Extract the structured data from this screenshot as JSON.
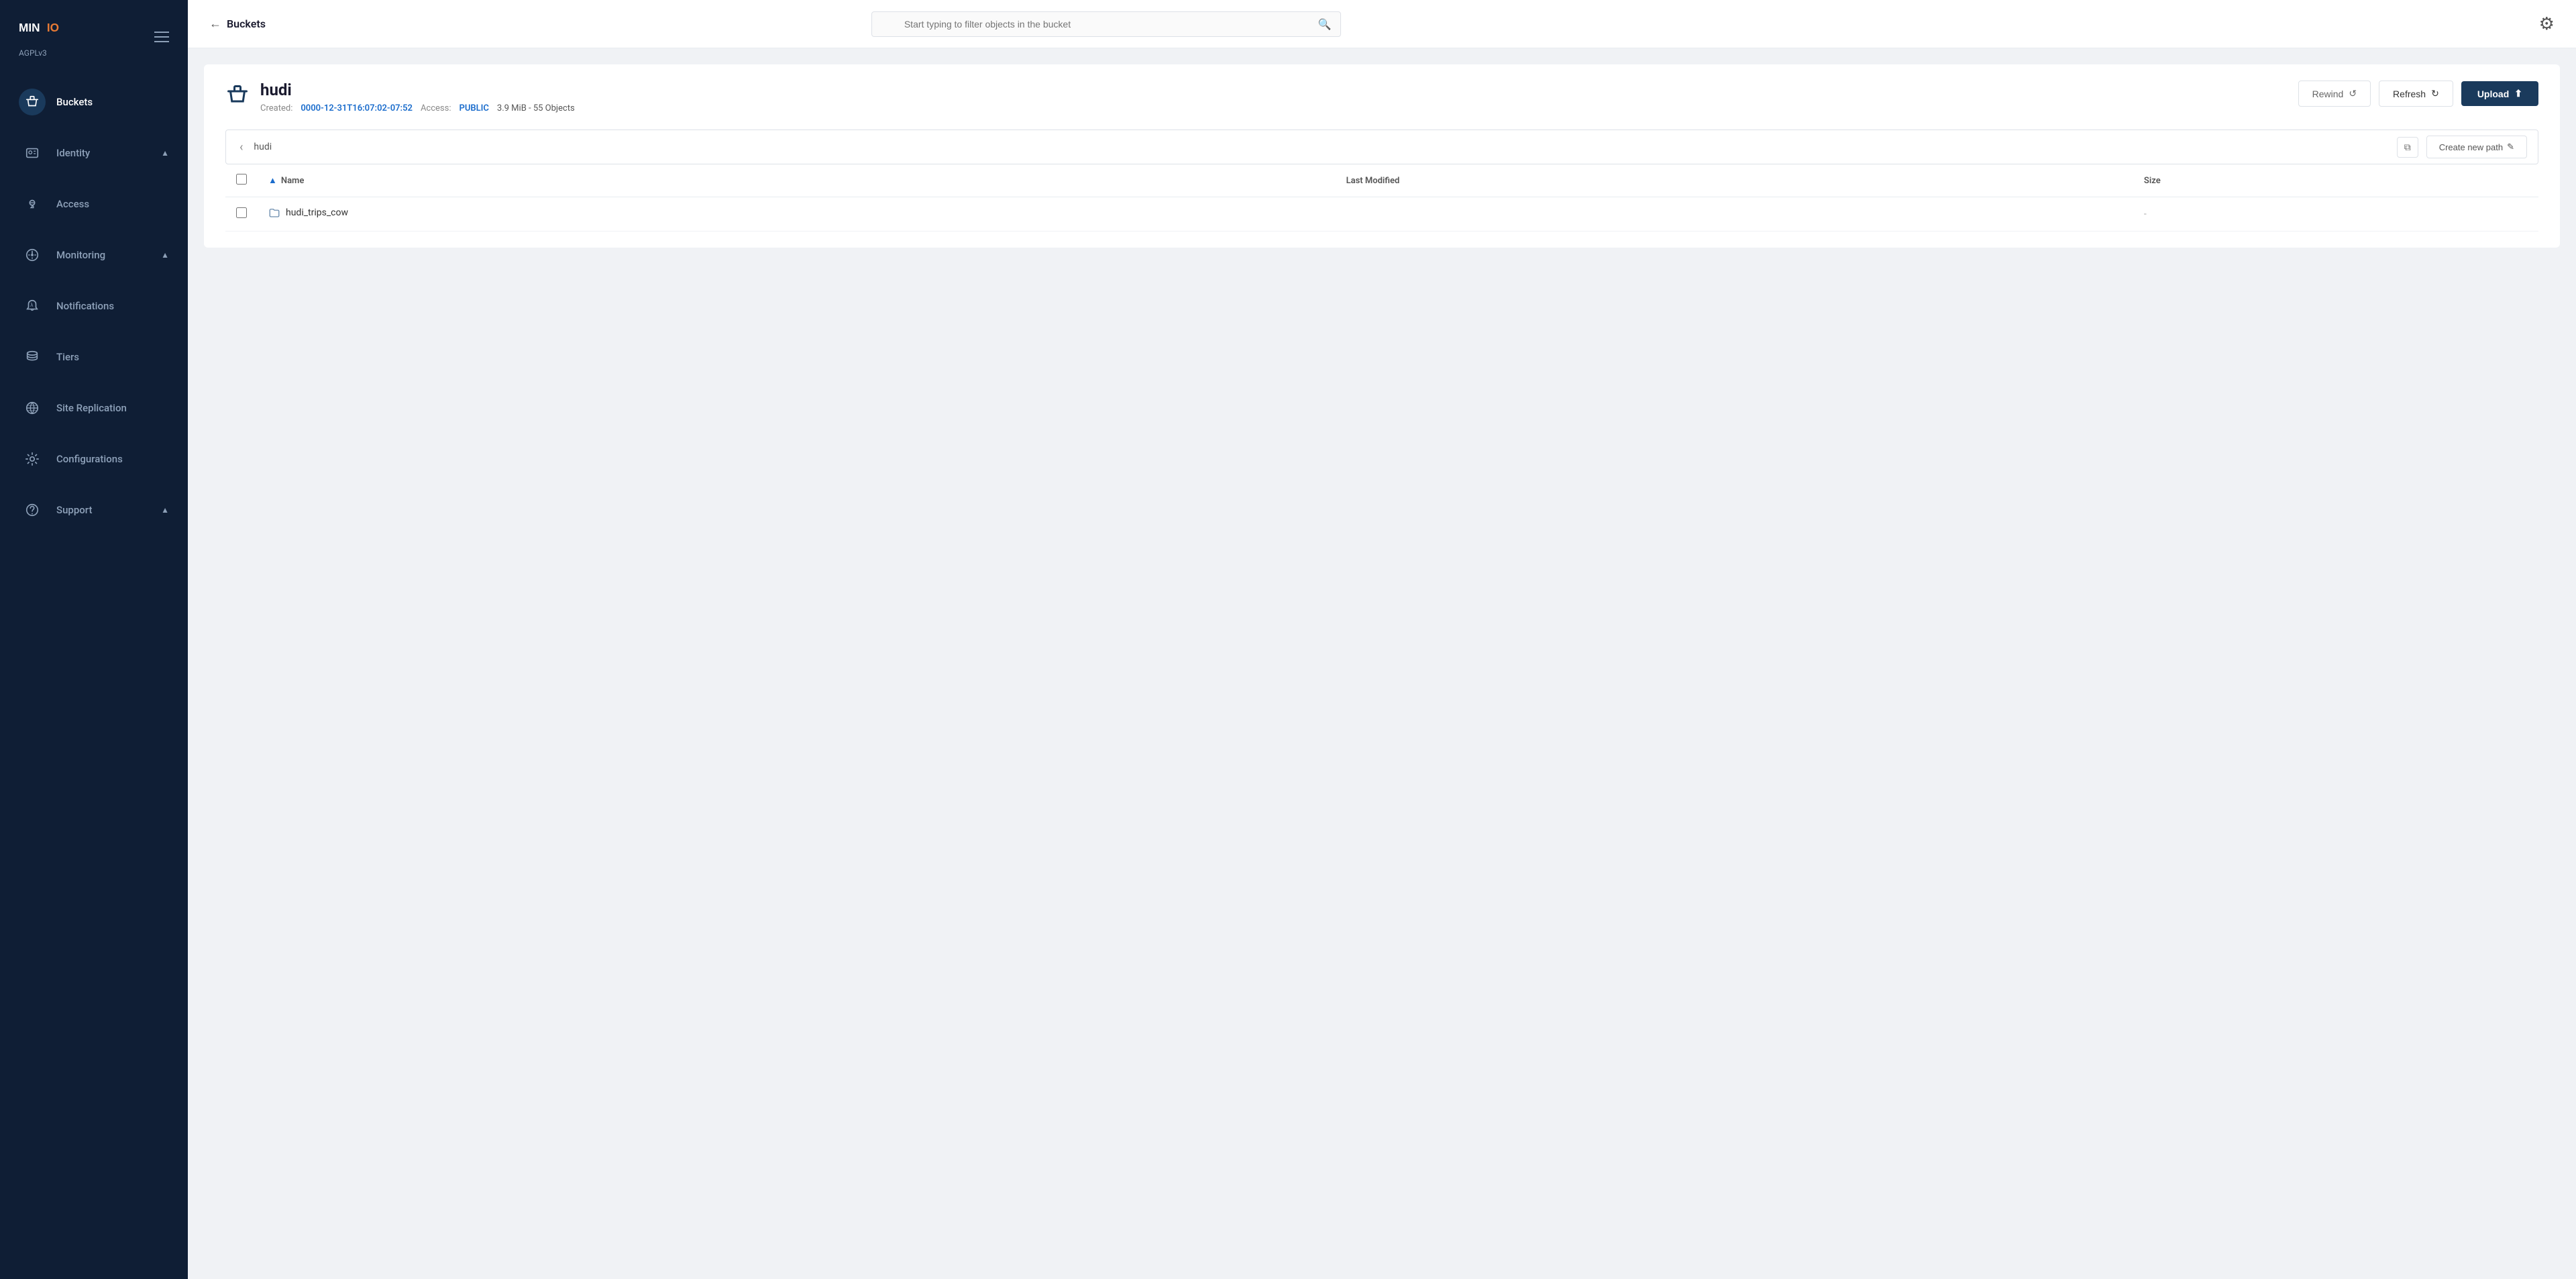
{
  "app": {
    "name": "MinIO",
    "version": "AGPLv3"
  },
  "sidebar": {
    "items": [
      {
        "id": "buckets",
        "label": "Buckets",
        "active": true,
        "icon": "bucket-icon",
        "hasChevron": false
      },
      {
        "id": "identity",
        "label": "Identity",
        "active": false,
        "icon": "identity-icon",
        "hasChevron": true
      },
      {
        "id": "access",
        "label": "Access",
        "active": false,
        "icon": "access-icon",
        "hasChevron": false
      },
      {
        "id": "monitoring",
        "label": "Monitoring",
        "active": false,
        "icon": "monitoring-icon",
        "hasChevron": true
      },
      {
        "id": "notifications",
        "label": "Notifications",
        "active": false,
        "icon": "notifications-icon",
        "hasChevron": false
      },
      {
        "id": "tiers",
        "label": "Tiers",
        "active": false,
        "icon": "tiers-icon",
        "hasChevron": false
      },
      {
        "id": "site-replication",
        "label": "Site Replication",
        "active": false,
        "icon": "site-replication-icon",
        "hasChevron": false
      },
      {
        "id": "configurations",
        "label": "Configurations",
        "active": false,
        "icon": "configurations-icon",
        "hasChevron": false
      },
      {
        "id": "support",
        "label": "Support",
        "active": false,
        "icon": "support-icon",
        "hasChevron": true
      }
    ]
  },
  "topbar": {
    "back_label": "Buckets",
    "search_placeholder": "Start typing to filter objects in the bucket"
  },
  "bucket": {
    "name": "hudi",
    "created_label": "Created:",
    "created_value": "0000-12-31T16:07:02-07:52",
    "access_label": "Access:",
    "access_value": "PUBLIC",
    "stats": "3.9 MiB - 55 Objects",
    "rewind_label": "Rewind",
    "refresh_label": "Refresh",
    "upload_label": "Upload"
  },
  "path_bar": {
    "path": "hudi",
    "create_path_label": "Create new path"
  },
  "table": {
    "columns": [
      {
        "id": "checkbox",
        "label": ""
      },
      {
        "id": "name",
        "label": "Name"
      },
      {
        "id": "last_modified",
        "label": "Last Modified"
      },
      {
        "id": "size",
        "label": "Size"
      }
    ],
    "rows": [
      {
        "name": "hudi_trips_cow",
        "last_modified": "",
        "size": "-",
        "type": "folder"
      }
    ]
  }
}
